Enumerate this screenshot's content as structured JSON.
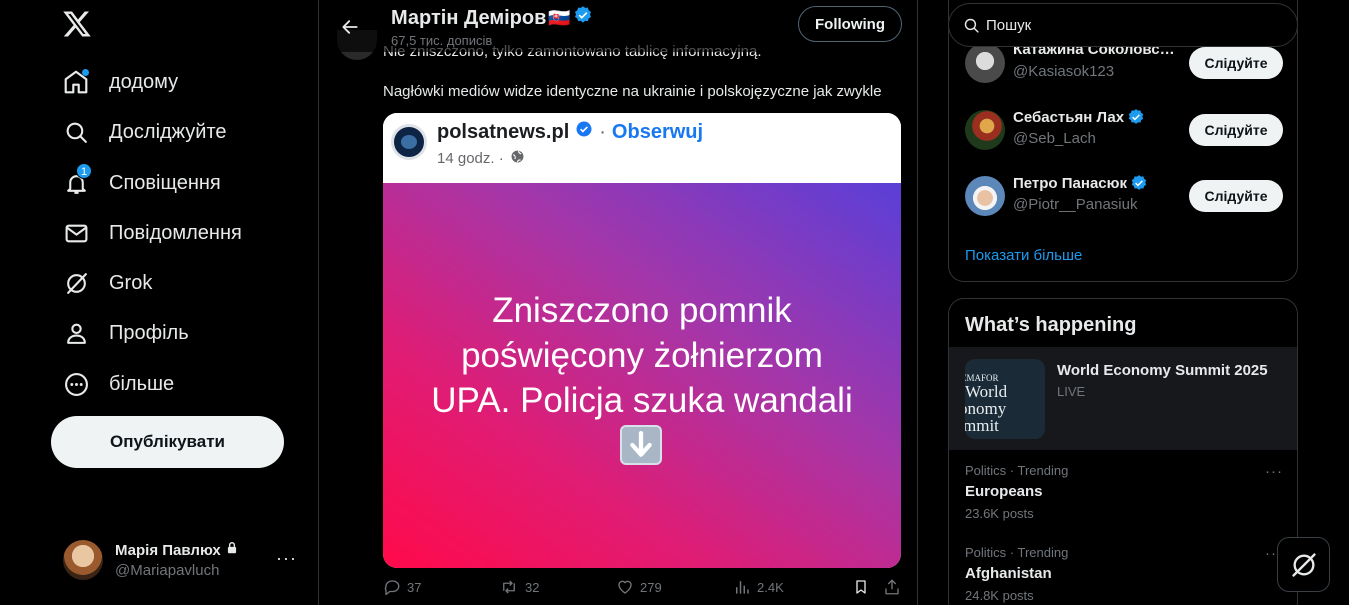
{
  "nav": {
    "items": [
      {
        "label": "додому",
        "icon": "home-icon"
      },
      {
        "label": "Досліджуйте",
        "icon": "search-icon"
      },
      {
        "label": "Сповіщення",
        "icon": "bell-icon",
        "badge": "1"
      },
      {
        "label": "Повідомлення",
        "icon": "mail-icon"
      },
      {
        "label": "Grok",
        "icon": "grok-icon"
      },
      {
        "label": "Профіль",
        "icon": "person-icon"
      },
      {
        "label": "більше",
        "icon": "more-circle-icon"
      }
    ],
    "post_label": "Опублікувати"
  },
  "account": {
    "name": "Марія Павлюх",
    "handle": "@Mariapavluch"
  },
  "header": {
    "name": "Мартін Деміров",
    "flag": "🇸🇰",
    "posts": "67,5 тис. дописів",
    "follow_label": "Following"
  },
  "tweet": {
    "line1": "Nie zniszczono, tylko zamontowano tablicę informacyjną.",
    "line2": "Nagłówki mediów widze identyczne na ukrainie i polskojęzyczne jak zwykle",
    "embed": {
      "source_name": "polsatnews.pl",
      "separator": "·",
      "follow_text": "Obserwuj",
      "time": "14 godz. ·",
      "caption_lines": [
        "Zniszczono pomnik",
        "poświęcony żołnierzom",
        "UPA. Policja szuka wandali"
      ]
    },
    "stats": {
      "replies": "37",
      "reposts": "32",
      "likes": "279",
      "views": "2.4K"
    }
  },
  "search": {
    "placeholder": "Пошук"
  },
  "who_to_follow": {
    "items": [
      {
        "name": "Катажина Соколовс…",
        "handle": "@Kasiasok123",
        "verified": false,
        "button": "Слідуйте"
      },
      {
        "name": "Себастьян Лах",
        "handle": "@Seb_Lach",
        "verified": true,
        "button": "Слідуйте"
      },
      {
        "name": "Петро Панасюк",
        "handle": "@Piotr__Panasiuk",
        "verified": true,
        "button": "Слідуйте"
      }
    ],
    "show_more": "Показати більше"
  },
  "trends": {
    "title": "What’s happening",
    "event": {
      "title": "World Economy Summit 2025",
      "status": "LIVE",
      "image_text": [
        "EMAFOR",
        "World",
        "onomy",
        "mmit"
      ]
    },
    "items": [
      {
        "category": "Politics · Trending",
        "name": "Europeans",
        "count": "23.6K posts"
      },
      {
        "category": "Politics · Trending",
        "name": "Afghanistan",
        "count": "24.8K posts"
      }
    ]
  },
  "colors": {
    "accent": "#1d9bf0",
    "background": "#000000",
    "border": "#2f3336",
    "muted": "#71767b"
  }
}
